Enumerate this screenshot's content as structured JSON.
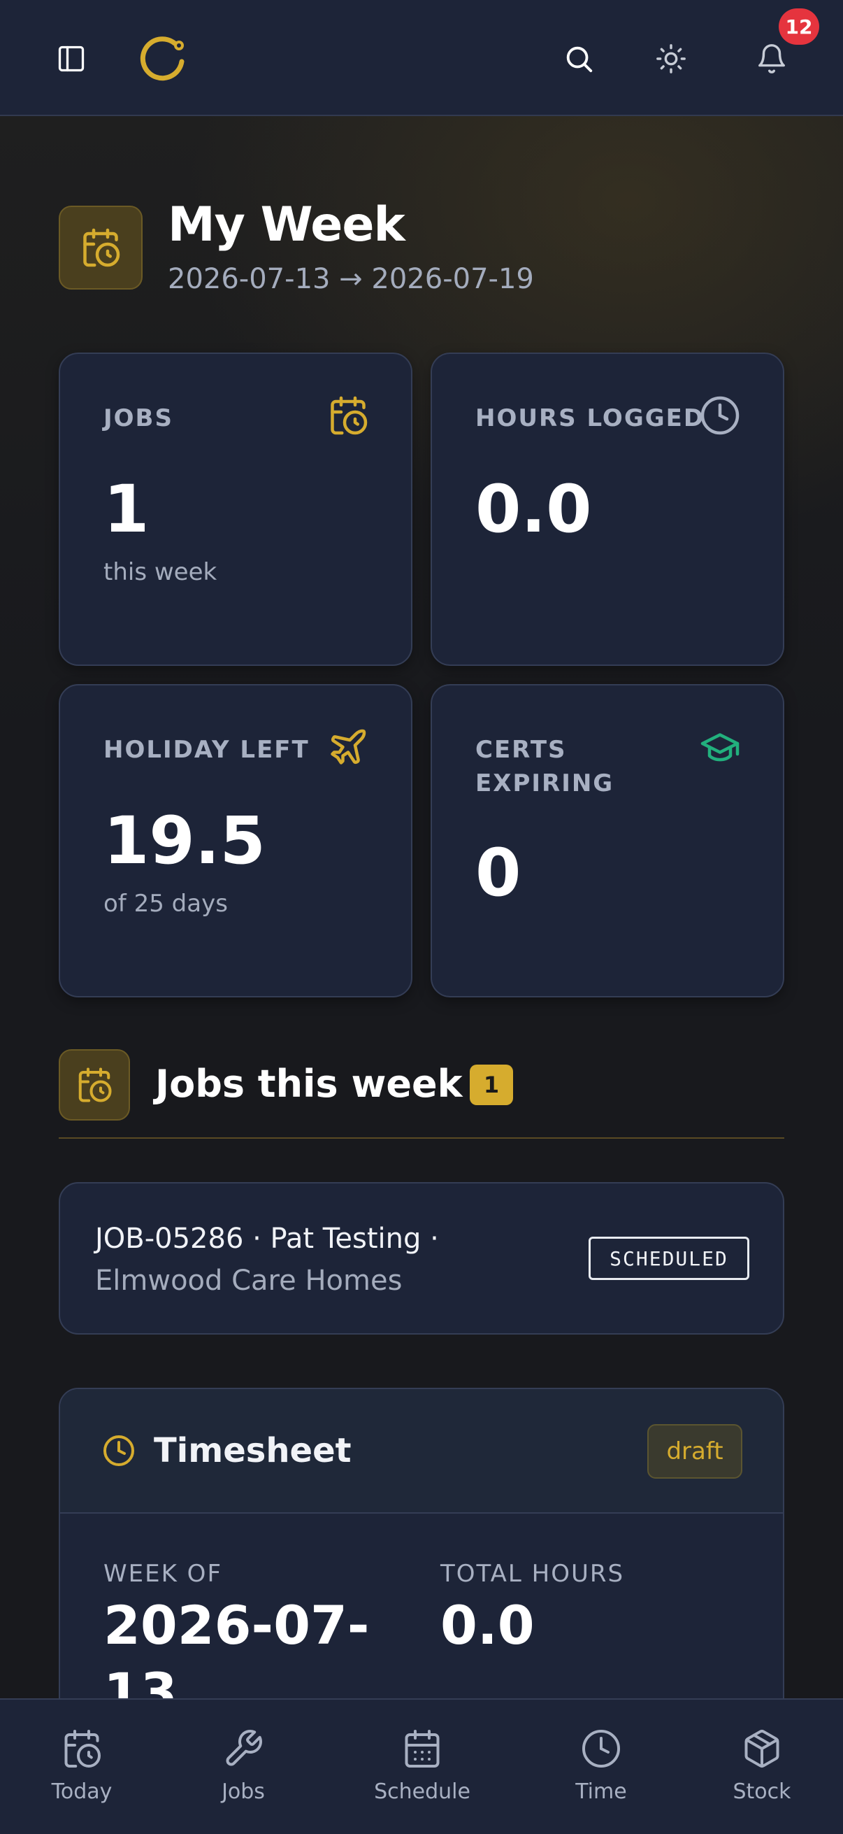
{
  "header": {
    "notification_count": "12"
  },
  "page": {
    "title": "My Week",
    "subtitle": "2026-07-13 → 2026-07-19"
  },
  "stats": [
    {
      "label": "JOBS",
      "value": "1",
      "sub": "this week",
      "icon": "calendar-clock-icon"
    },
    {
      "label": "HOURS LOGGED",
      "value": "0.0",
      "sub": "",
      "icon": "clock-icon"
    },
    {
      "label": "HOLIDAY LEFT",
      "value": "19.5",
      "sub": "of 25 days",
      "icon": "plane-icon"
    },
    {
      "label": "CERTS EXPIRING",
      "value": "0",
      "sub": "",
      "icon": "graduation-cap-icon"
    }
  ],
  "jobs_section": {
    "title": "Jobs this week",
    "count": "1",
    "jobs": [
      {
        "line1": "JOB-05286 · Pat Testing ·",
        "line2": "Elmwood Care Homes",
        "status": "SCHEDULED"
      }
    ]
  },
  "timesheet": {
    "title": "Timesheet",
    "status": "draft",
    "week_of_label": "WEEK OF",
    "week_of_value": "2026-07-13",
    "total_hours_label": "TOTAL HOURS",
    "total_hours_value": "0.0"
  },
  "bottom_nav": [
    {
      "label": "Today",
      "icon": "calendar-clock-icon"
    },
    {
      "label": "Jobs",
      "icon": "wrench-icon"
    },
    {
      "label": "Schedule",
      "icon": "calendar-grid-icon"
    },
    {
      "label": "Time",
      "icon": "clock-icon"
    },
    {
      "label": "Stock",
      "icon": "package-icon"
    }
  ],
  "colors": {
    "accent": "#d6ac2e",
    "success": "#22b07d",
    "danger": "#e5343e",
    "surface": "#1d2438"
  }
}
